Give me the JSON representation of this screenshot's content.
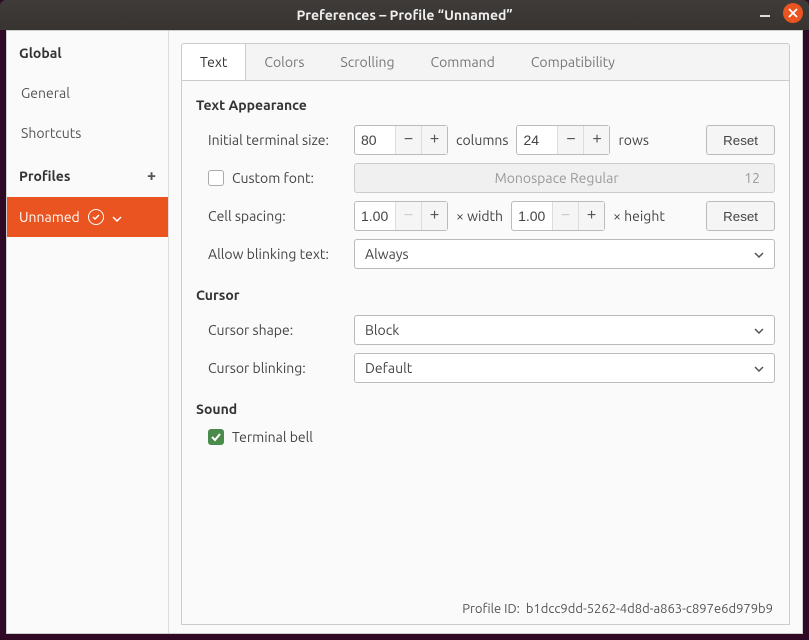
{
  "window": {
    "title": "Preferences – Profile “Unnamed”"
  },
  "sidebar": {
    "global_header": "Global",
    "items": {
      "general": "General",
      "shortcuts": "Shortcuts"
    },
    "profiles_header": "Profiles",
    "profile_selected": "Unnamed"
  },
  "tabs": {
    "text": "Text",
    "colors": "Colors",
    "scrolling": "Scrolling",
    "command": "Command",
    "compatibility": "Compatibility"
  },
  "sections": {
    "text_appearance": "Text Appearance",
    "cursor": "Cursor",
    "sound": "Sound"
  },
  "labels": {
    "initial_size": "Initial terminal size:",
    "columns": "columns",
    "rows": "rows",
    "reset": "Reset",
    "custom_font": "Custom font:",
    "font_name": "Monospace Regular",
    "font_size": "12",
    "cell_spacing": "Cell spacing:",
    "width": "× width",
    "height": "× height",
    "allow_blinking": "Allow blinking text:",
    "always": "Always",
    "cursor_shape": "Cursor shape:",
    "block": "Block",
    "cursor_blinking": "Cursor blinking:",
    "default": "Default",
    "terminal_bell": "Terminal bell",
    "profile_id_label": "Profile ID:",
    "profile_id_value": "b1dcc9dd-5262-4d8d-a863-c897e6d979b9"
  },
  "values": {
    "cols": "80",
    "rows": "24",
    "cell_w": "1.00",
    "cell_h": "1.00",
    "custom_font_checked": false,
    "terminal_bell_checked": true
  }
}
